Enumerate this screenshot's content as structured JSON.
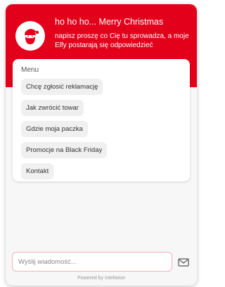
{
  "header": {
    "title": "ho ho ho... Merry Christmas",
    "subtitle": "napisz proszę co Cię tu sprowadza, a moje Elfy postarają się odpowiedzieć",
    "accent_color": "#e3001b",
    "avatar_icon": "santa-icon"
  },
  "menu": {
    "title": "Menu",
    "items": [
      {
        "label": "Chcę zgłosić reklamację"
      },
      {
        "label": "Jak zwrócić towar"
      },
      {
        "label": "Gdzie moja paczka"
      },
      {
        "label": "Promocje na Black Friday"
      },
      {
        "label": "Kontakt"
      }
    ]
  },
  "composer": {
    "placeholder": "Wyślij wiadomość...",
    "send_icon": "envelope-icon"
  },
  "footer": {
    "powered_by": "Powered by Inteliwise"
  }
}
